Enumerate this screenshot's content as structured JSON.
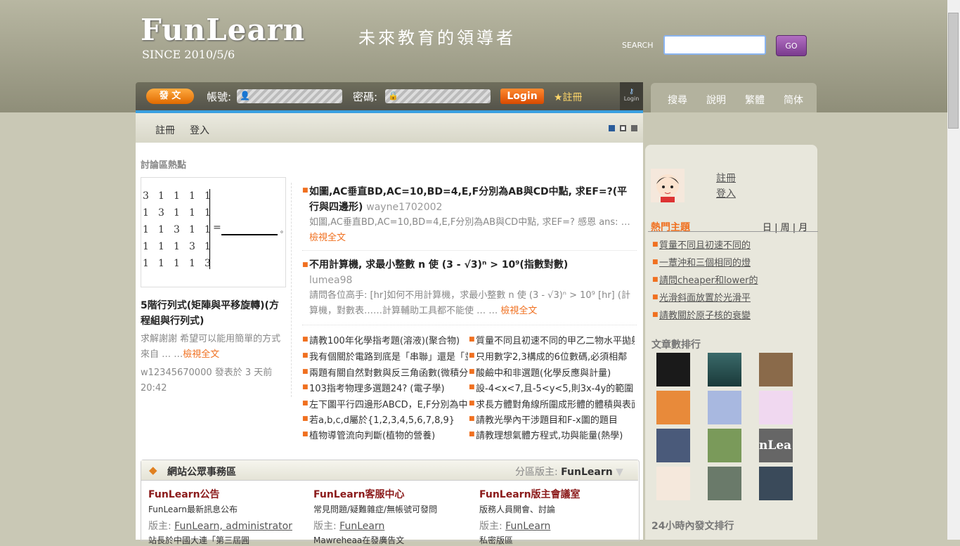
{
  "header": {
    "logo": "FunLearn",
    "since": "SINCE 2010/5/6",
    "slogan": "未來教育的領導者",
    "search_label": "SEARCH",
    "search_value": "",
    "go_label": "GO"
  },
  "loginbar": {
    "post_label": "發 文",
    "account_label": "帳號:",
    "password_label": "密碼:",
    "login_label": "Login",
    "register_label": "★註冊",
    "login_icon_label": "Login"
  },
  "topnav": [
    "搜尋",
    "說明",
    "繁體",
    "简体"
  ],
  "subnav": [
    "註冊",
    "登入"
  ],
  "main": {
    "section_title": "討論區熱點",
    "matrix": [
      [
        "3",
        "1",
        "1",
        "1",
        "1"
      ],
      [
        "1",
        "3",
        "1",
        "1",
        "1"
      ],
      [
        "1",
        "1",
        "3",
        "1",
        "1"
      ],
      [
        "1",
        "1",
        "1",
        "3",
        "1"
      ],
      [
        "1",
        "1",
        "1",
        "1",
        "3"
      ]
    ],
    "matrix_eq": "=",
    "matrix_end": "。",
    "featured": {
      "title": "5階行列式(矩陣與平移旋轉)(方程組與行列式)",
      "desc": "求解謝謝 希望可以能用簡單的方式 來自 … …",
      "readmore": "檢視全文",
      "meta": "w12345670000 發表於 3 天前 20:42"
    },
    "topics": [
      {
        "title": "如圖,AC垂直BD,AC=10,BD=4,E,F分別為AB與CD中點, 求EF=?(平行與四邊形)",
        "author": "wayne1702002",
        "desc": "如圖,AC垂直BD,AC=10,BD=4,E,F分別為AB與CD中點, 求EF=? 感恩 ans: …",
        "readmore": "檢視全文"
      },
      {
        "title": "不用計算機, 求最小整數 n 使 (3 - √3)ⁿ > 10⁹(指數對數)",
        "author": "lumea98",
        "desc": "請問各位高手:  [hr]如何不用計算機，求最小整數 n 使 (3 - √3)ⁿ > 10⁹ [hr] (計算機，對數表……計算輔助工具都不能使 … …",
        "readmore": "檢視全文"
      }
    ],
    "list_left": [
      "請教100年化學指考題(溶液)(聚合物)",
      "我有個關於電路到底是「串聯」還是「並聯」",
      "兩題有關自然對數與反三角函數(微積分)",
      "103指考物理多選題24? (電子學)",
      "左下圖平行四邊形ABCD，E,F分別為中點",
      "若a,b,c,d屬於{1,2,3,4,5,6,7,8,9}",
      "植物導管流向判斷(植物的營養)"
    ],
    "list_right": [
      "質量不同且初速不同的甲乙二物水平拋射",
      "只用數字2,3構成的6位數碼,必須相鄰",
      "酸鹼中和非選題(化學反應與計量)",
      "設-4<x<7,且-5<y<5,則3x-4y的範圍",
      "求長方體對角線所圍成形體的體積與表面積",
      "請教光學內干涉題目和F-x圖的題目",
      "請教理想氣體方程式,功與能量(熱學)"
    ]
  },
  "board": {
    "title": "網站公眾事務區",
    "mod_label": "分區版主:",
    "mod_name": "FunLearn",
    "forums": [
      {
        "title": "FunLearn公告",
        "desc": "FunLearn最新訊息公布",
        "mod_label": "版主:",
        "mods": "FunLearn, administrator",
        "extra": "站長於中國大連「第三屆圓"
      },
      {
        "title": "FunLearn客服中心",
        "desc": "常見問題/疑難雜症/無帳號可發問",
        "mod_label": "版主:",
        "mods": "FunLearn",
        "extra": "Mawreheaa在發廣告文"
      },
      {
        "title": "FunLearn版主會議室",
        "desc": "版務人員開會、討論",
        "mod_label": "版主:",
        "mods": "FunLearn",
        "extra": "私密版區"
      }
    ]
  },
  "right": {
    "links": [
      "註冊",
      "登入"
    ],
    "hot_title": "熱門主題",
    "hot_tabs": "日 | 周 | 月",
    "hot_items": [
      "質量不同且初速不同的",
      "一蕈沖和三個相同的燈",
      "請問cheaper和lower的",
      "光滑斜面放置於光滑平",
      "請教關於原子核的衰變"
    ],
    "rank_title": "文章數排行",
    "rank24_title": "24小時內發文排行",
    "thumb_text": "nLea"
  },
  "colors": {
    "accent": "#f07020",
    "header_bg": "#a6a591",
    "link_blue": "#3aa0e0",
    "go_purple": "#8e4aa2"
  }
}
